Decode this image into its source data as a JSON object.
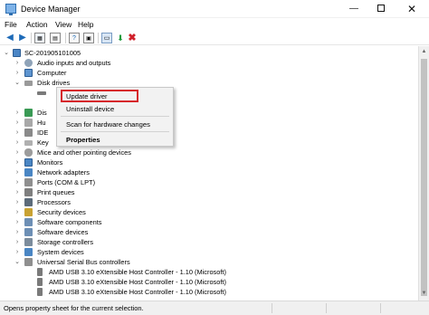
{
  "window": {
    "title": "Device Manager",
    "minimize": "—",
    "close": "✕"
  },
  "menu": [
    "File",
    "Action",
    "View",
    "Help"
  ],
  "colors": {
    "accent_red": "#d6262b",
    "toolbar_blue": "#1e6bb8",
    "uninstall_red": "#d0202a"
  },
  "tree": {
    "root": "SC-201905101005",
    "items": [
      {
        "label": "Audio inputs and outputs",
        "icon": "speaker-icon"
      },
      {
        "label": "Computer",
        "icon": "computer-icon"
      },
      {
        "label": "Disk drives",
        "icon": "disk-icon",
        "expanded": true
      },
      {
        "label": "",
        "icon": "disk-drive-icon"
      },
      {
        "label": "Dis",
        "icon": "display-adapter-icon"
      },
      {
        "label": "Hu",
        "icon": "hid-icon"
      },
      {
        "label": "IDE",
        "icon": "ide-controller-icon"
      },
      {
        "label": "Key",
        "icon": "keyboard-icon"
      },
      {
        "label": "Mice and other pointing devices",
        "icon": "mouse-icon"
      },
      {
        "label": "Monitors",
        "icon": "monitor-icon"
      },
      {
        "label": "Network adapters",
        "icon": "network-icon"
      },
      {
        "label": "Ports (COM & LPT)",
        "icon": "port-icon"
      },
      {
        "label": "Print queues",
        "icon": "printer-icon"
      },
      {
        "label": "Processors",
        "icon": "processor-icon"
      },
      {
        "label": "Security devices",
        "icon": "security-icon"
      },
      {
        "label": "Software components",
        "icon": "software-component-icon"
      },
      {
        "label": "Software devices",
        "icon": "software-device-icon"
      },
      {
        "label": "Storage controllers",
        "icon": "storage-icon"
      },
      {
        "label": "System devices",
        "icon": "system-icon"
      },
      {
        "label": "Universal Serial Bus controllers",
        "icon": "usb-icon",
        "expanded": true
      },
      {
        "label": "AMD USB 3.10 eXtensible Host Controller - 1.10 (Microsoft)",
        "icon": "usb-device-icon"
      },
      {
        "label": "AMD USB 3.10 eXtensible Host Controller - 1.10 (Microsoft)",
        "icon": "usb-device-icon"
      },
      {
        "label": "AMD USB 3.10 eXtensible Host Controller - 1.10 (Microsoft)",
        "icon": "usb-device-icon"
      }
    ]
  },
  "context_menu": {
    "update_driver": "Update driver",
    "uninstall_device": "Uninstall device",
    "scan_hardware": "Scan for hardware changes",
    "properties": "Properties"
  },
  "status": "Opens property sheet for the current selection."
}
